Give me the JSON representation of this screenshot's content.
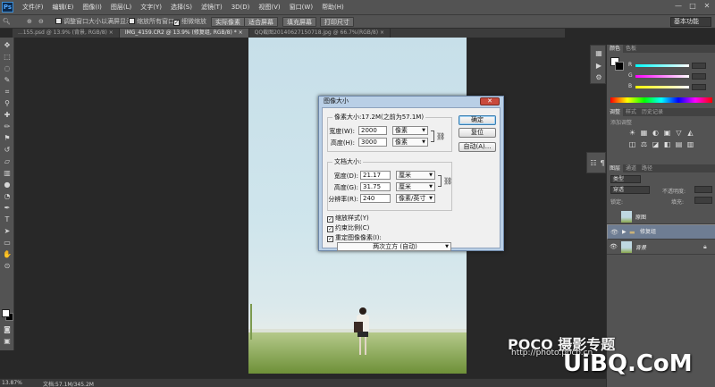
{
  "app": {
    "logo": "Ps"
  },
  "menubar": {
    "items": [
      "文件(F)",
      "编辑(E)",
      "图像(I)",
      "图层(L)",
      "文字(Y)",
      "选择(S)",
      "滤镜(T)",
      "3D(D)",
      "视图(V)",
      "窗口(W)",
      "帮助(H)"
    ],
    "window_controls": [
      "—",
      "□",
      "✕"
    ]
  },
  "options": {
    "resize_windows": "调整窗口大小以满屏显示",
    "zoom_all_windows": "缩放所有窗口",
    "scrubby_zoom": "细微缩放",
    "actual_pixels": "实际像素",
    "fit_screen": "适合屏幕",
    "fill_screen": "填充屏幕",
    "print_size": "打印尺寸",
    "workspace": "基本功能"
  },
  "tabs": [
    {
      "label": "...155.psd @ 13.9% (背景, RGB/8) ×",
      "active": false
    },
    {
      "label": "IMG_4159.CR2 @ 13.9% (修复组, RGB/8) * ×",
      "active": true
    },
    {
      "label": "QQ截图20140627150718.jpg @ 66.7%(RGB/8) ×",
      "active": false
    }
  ],
  "dialog": {
    "title": "图像大小",
    "close": "✕",
    "pixel_dims": {
      "legend": "像素大小:17.2M(之前为57.1M)",
      "width_label": "宽度(W):",
      "width_value": "2000",
      "width_unit": "像素",
      "height_label": "高度(H):",
      "height_value": "3000",
      "height_unit": "像素"
    },
    "doc_size": {
      "legend": "文档大小:",
      "width_label": "宽度(D):",
      "width_value": "21.17",
      "width_unit": "厘米",
      "height_label": "高度(G):",
      "height_value": "31.75",
      "height_unit": "厘米",
      "res_label": "分辨率(R):",
      "res_value": "240",
      "res_unit": "像素/英寸"
    },
    "buttons": {
      "ok": "确定",
      "reset": "复位",
      "auto": "自动(A)..."
    },
    "checks": {
      "scale_styles": "缩放样式(Y)",
      "constrain": "约束比例(C)",
      "resample": "重定图像像素(I):",
      "mark": "✓"
    },
    "resample_method": "两次立方 (自动)"
  },
  "panels": {
    "color_tabs": [
      "颜色",
      "色板"
    ],
    "slider_labels": [
      "R",
      "G",
      "B"
    ],
    "adjust_tabs": [
      "调整",
      "样式",
      "历史记录"
    ],
    "adjust_title": "添加调整",
    "adjust_row1": [
      "☀",
      "▦",
      "◐",
      "▣",
      "▽",
      "◭"
    ],
    "adjust_row2": [
      "◫",
      "⚖",
      "◪",
      "◧",
      "▤",
      "▥"
    ],
    "layers_tabs": [
      "图层",
      "通道",
      "路径"
    ],
    "kind": "类型",
    "blend_mode": "穿透",
    "opacity_label": "不透明度:",
    "lock_label": "锁定:",
    "fill_label": "填充:",
    "layers": [
      {
        "name": "原图",
        "visible": false,
        "selected": false,
        "italic": false
      },
      {
        "name": "修复组",
        "visible": true,
        "selected": true,
        "italic": false
      },
      {
        "name": "背景",
        "visible": true,
        "selected": false,
        "italic": true
      }
    ]
  },
  "status": {
    "zoom": "13.87%",
    "doc_size": "文档:57.1M/345.2M"
  },
  "watermarks": {
    "poco": "POCO 摄影专题",
    "url": "http://photo.poco.cn",
    "uibq": "UiBQ.CoM"
  },
  "colors": {
    "accent": "#3d8fd6",
    "selected_layer": "#6e7d93",
    "dialog_frame": "#b9cfe6"
  }
}
